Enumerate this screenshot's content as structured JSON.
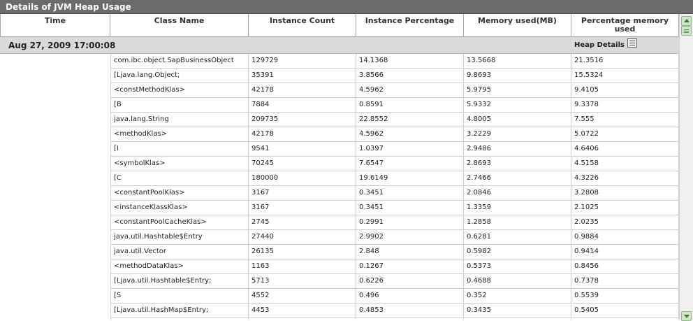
{
  "panel": {
    "title": "Details of JVM Heap Usage"
  },
  "table": {
    "columns": [
      "Time",
      "Class Name",
      "Instance Count",
      "Instance Percentage",
      "Memory used(MB)",
      "Percentage memory used"
    ],
    "group": {
      "time": "Aug 27, 2009 17:00:08",
      "heap_details_label": "Heap Details"
    },
    "rows": [
      [
        "com.ibc.object.SapBusinessObject",
        "129729",
        "14.1368",
        "13.5668",
        "21.3516"
      ],
      [
        "[Ljava.lang.Object;",
        "35391",
        "3.8566",
        "9.8693",
        "15.5324"
      ],
      [
        "<constMethodKlas>",
        "42178",
        "4.5962",
        "5.9795",
        "9.4105"
      ],
      [
        "[B",
        "7884",
        "0.8591",
        "5.9332",
        "9.3378"
      ],
      [
        "java.lang.String",
        "209735",
        "22.8552",
        "4.8005",
        "7.555"
      ],
      [
        "<methodKlas>",
        "42178",
        "4.5962",
        "3.2229",
        "5.0722"
      ],
      [
        "[I",
        "9541",
        "1.0397",
        "2.9486",
        "4.6406"
      ],
      [
        "<symbolKlas>",
        "70245",
        "7.6547",
        "2.8693",
        "4.5158"
      ],
      [
        "[C",
        "180000",
        "19.6149",
        "2.7466",
        "4.3226"
      ],
      [
        "<constantPoolKlas>",
        "3167",
        "0.3451",
        "2.0846",
        "3.2808"
      ],
      [
        "<instanceKlassKlas>",
        "3167",
        "0.3451",
        "1.3359",
        "2.1025"
      ],
      [
        "<constantPoolCacheKlas>",
        "2745",
        "0.2991",
        "1.2858",
        "2.0235"
      ],
      [
        "java.util.Hashtable$Entry",
        "27440",
        "2.9902",
        "0.6281",
        "0.9884"
      ],
      [
        "java.util.Vector",
        "26135",
        "2.848",
        "0.5982",
        "0.9414"
      ],
      [
        "<methodDataKlas>",
        "1163",
        "0.1267",
        "0.5373",
        "0.8456"
      ],
      [
        "[Ljava.util.Hashtable$Entry;",
        "5713",
        "0.6226",
        "0.4688",
        "0.7378"
      ],
      [
        "[S",
        "4552",
        "0.496",
        "0.352",
        "0.5539"
      ],
      [
        "[Ljava.util.HashMap$Entry;",
        "4453",
        "0.4853",
        "0.3435",
        "0.5405"
      ],
      [
        "",
        "",
        "",
        "",
        ""
      ]
    ]
  }
}
